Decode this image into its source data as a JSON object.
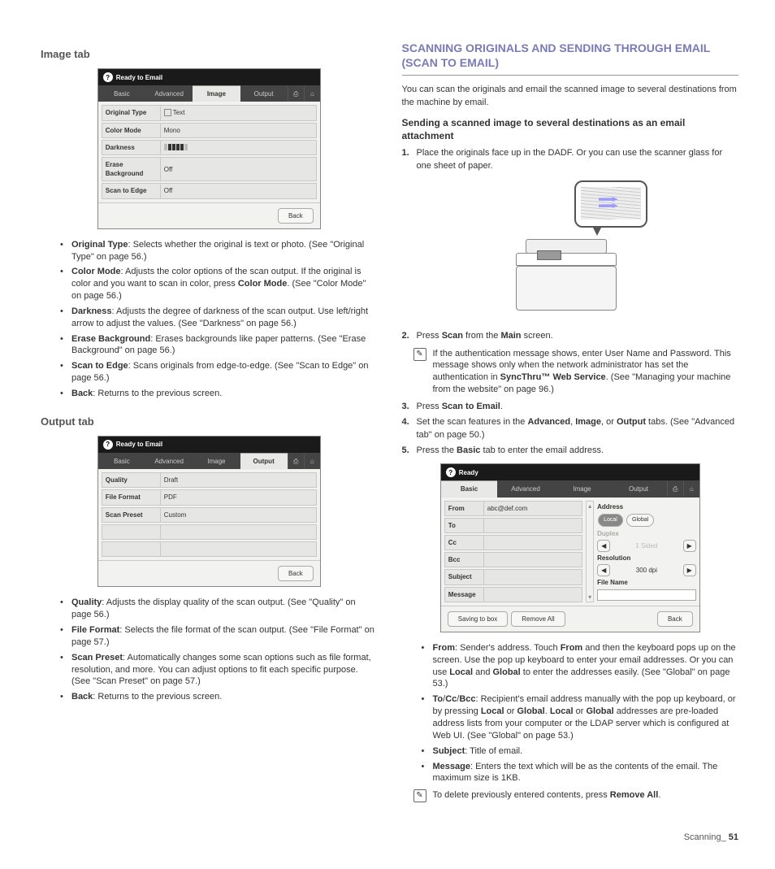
{
  "left": {
    "image_tab": {
      "title": "Image tab",
      "panel": {
        "status": "Ready to Email",
        "tabs": [
          "Basic",
          "Advanced",
          "Image",
          "Output"
        ],
        "active_tab": "Image",
        "rows": [
          {
            "label": "Original Type",
            "value": "Text"
          },
          {
            "label": "Color Mode",
            "value": "Mono"
          },
          {
            "label": "Darkness",
            "value": ""
          },
          {
            "label": "Erase Background",
            "value": "Off"
          },
          {
            "label": "Scan to Edge",
            "value": "Off"
          }
        ],
        "back": "Back"
      },
      "bullets": [
        {
          "b": "Original Type",
          "t": ": Selects whether the original is text or photo. (See \"Original Type\" on page 56.)"
        },
        {
          "b": "Color Mode",
          "t": ": Adjusts the color options of the scan output. If the original is color and you want to scan in color, press ",
          "b2": "Color Mode",
          "t2": ". (See \"Color Mode\" on page 56.)"
        },
        {
          "b": "Darkness",
          "t": ": Adjusts the degree of darkness of the scan output. Use left/right arrow to adjust the values. (See \"Darkness\" on page 56.)"
        },
        {
          "b": "Erase Background",
          "t": ": Erases backgrounds like paper patterns. (See \"Erase Background\" on page 56.)"
        },
        {
          "b": "Scan to Edge",
          "t": ": Scans originals from edge-to-edge. (See \"Scan to Edge\" on page 56.)"
        },
        {
          "b": "Back",
          "t": ": Returns to the previous screen."
        }
      ]
    },
    "output_tab": {
      "title": "Output tab",
      "panel": {
        "status": "Ready to Email",
        "tabs": [
          "Basic",
          "Advanced",
          "Image",
          "Output"
        ],
        "active_tab": "Output",
        "rows": [
          {
            "label": "Quality",
            "value": "Draft"
          },
          {
            "label": "File Format",
            "value": "PDF"
          },
          {
            "label": "Scan Preset",
            "value": "Custom"
          }
        ],
        "back": "Back"
      },
      "bullets": [
        {
          "b": "Quality",
          "t": ": Adjusts the display quality of the scan output. (See \"Quality\" on page 56.)"
        },
        {
          "b": "File Format",
          "t": ": Selects the file format of the scan output. (See \"File Format\" on page 57.)"
        },
        {
          "b": "Scan Preset",
          "t": ": Automatically changes some scan options such as file format, resolution, and more. You can adjust options to fit each specific purpose. (See \"Scan Preset\" on page 57.)"
        },
        {
          "b": "Back",
          "t": ": Returns to the previous screen."
        }
      ]
    }
  },
  "right": {
    "heading": "SCANNING ORIGINALS AND SENDING THROUGH EMAIL (SCAN TO EMAIL)",
    "intro": "You can scan the originals and email the scanned image to several destinations from the machine by email.",
    "sub1": "Sending a scanned image to several destinations as an email attachment",
    "steps1": [
      "Place the originals face up in the DADF. Or you can use the scanner glass for one sheet of paper."
    ],
    "step2_pre": "Press ",
    "step2_b1": "Scan",
    "step2_mid": " from the ",
    "step2_b2": "Main",
    "step2_end": " screen.",
    "note1": "If the authentication message shows, enter User Name and Password. This message shows only when the network administrator has set the authentication in ",
    "note1_b": "SyncThru™ Web Service",
    "note1_end": ". (See \"Managing your machine from the website\" on page 96.)",
    "step3_pre": "Press ",
    "step3_b": "Scan to Email",
    "step3_end": ".",
    "step4_pre": "Set the scan features in the ",
    "step4_b1": "Advanced",
    "step4_c1": ", ",
    "step4_b2": "Image",
    "step4_c2": ", or ",
    "step4_b3": "Output",
    "step4_end": " tabs. (See \"Advanced tab\" on page 50.)",
    "step5_pre": "Press the ",
    "step5_b": "Basic",
    "step5_end": " tab to enter the email address.",
    "epanel": {
      "status": "Ready",
      "tabs": [
        "Basic",
        "Advanced",
        "Image",
        "Output"
      ],
      "active_tab": "Basic",
      "left_labels": [
        "From",
        "To",
        "Cc",
        "Bcc",
        "Subject",
        "Message"
      ],
      "from_value": "abc@def.com",
      "address": "Address",
      "local": "Local",
      "global": "Global",
      "duplex": "Duplex",
      "sided": "1 Sided",
      "resolution": "Resolution",
      "dpi": "300 dpi",
      "filename": "File Name",
      "saving": "Saving to box",
      "remove": "Remove All",
      "back": "Back"
    },
    "bullets2": [
      {
        "b": "From",
        "t": ": Sender's address. Touch ",
        "b2": "From",
        "t2": " and then the keyboard pops up on the screen. Use the pop up keyboard to enter your email addresses. Or you can use ",
        "b3": "Local",
        "t3": " and ",
        "b4": "Global",
        "t4": " to enter the addresses easily. (See \"Global\" on page 53.)"
      },
      {
        "b": "To",
        "ext": "/",
        "b2": "Cc",
        "ext2": "/",
        "b3": "Bcc",
        "t": ": Recipient's email address manually with the pop up keyboard, or by pressing ",
        "b4": "Local",
        "t2": " or ",
        "b5": "Global",
        "t3": ". ",
        "b6": "Local",
        "t4": " or ",
        "b7": "Global",
        "t5": " addresses are pre-loaded address lists from your computer or the LDAP server which is configured at Web UI. (See \"Global\" on page 53.)"
      },
      {
        "b": "Subject",
        "t": ": Title of email."
      },
      {
        "b": "Message",
        "t": ": Enters the text which will be as the contents of the email. The maximum size is 1KB."
      }
    ],
    "note2": "To delete previously entered contents, press ",
    "note2_b": "Remove All",
    "note2_end": "."
  },
  "footer": {
    "section": "Scanning",
    "sep": "_ ",
    "page": "51"
  }
}
